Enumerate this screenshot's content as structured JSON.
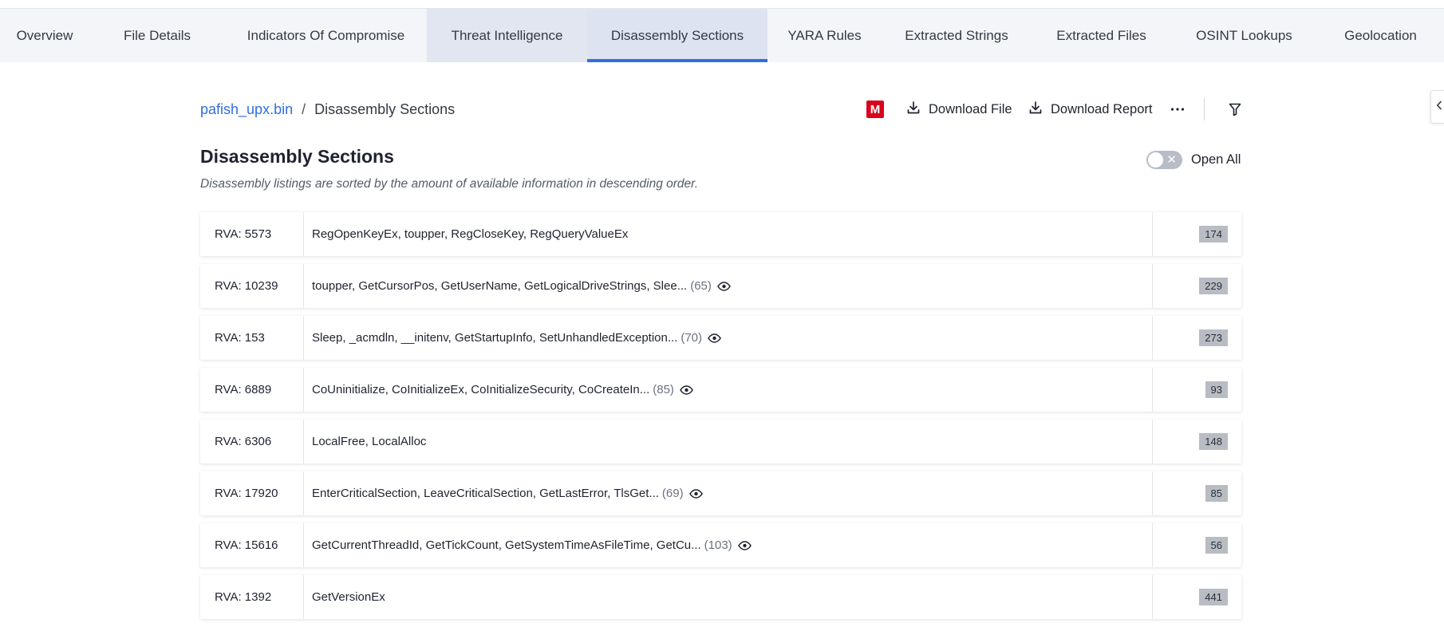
{
  "tabs": [
    {
      "label": "Overview"
    },
    {
      "label": "File Details"
    },
    {
      "label": "Indicators Of Compromise"
    },
    {
      "label": "Threat Intelligence"
    },
    {
      "label": "Disassembly Sections"
    },
    {
      "label": "YARA Rules"
    },
    {
      "label": "Extracted Strings"
    },
    {
      "label": "Extracted Files"
    },
    {
      "label": "OSINT Lookups"
    },
    {
      "label": "Geolocation"
    }
  ],
  "active_tab": "Disassembly Sections",
  "breadcrumb": {
    "file": "pafish_upx.bin",
    "separator": "/",
    "current": "Disassembly Sections"
  },
  "toolbar": {
    "badge_letter": "M",
    "badge_color": "#d9041b",
    "download_file": "Download File",
    "download_report": "Download Report",
    "more_icon": "ellipsis-icon",
    "filter_icon": "filter-icon"
  },
  "section": {
    "title": "Disassembly Sections",
    "subtitle": "Disassembly listings are sorted by the amount of available information in descending order.",
    "toggle_label": "Open All",
    "toggle_on": false
  },
  "accent_color": "#2f6fe0",
  "rows": [
    {
      "rva": "RVA: 5573",
      "functions": "RegOpenKeyEx, toupper, RegCloseKey, RegQueryValueEx",
      "more": "",
      "count": "174"
    },
    {
      "rva": "RVA: 10239",
      "functions": "toupper, GetCursorPos, GetUserName, GetLogicalDriveStrings, Slee...",
      "more": "(65)",
      "count": "229"
    },
    {
      "rva": "RVA: 153",
      "functions": "Sleep, _acmdln, __initenv, GetStartupInfo, SetUnhandledException...",
      "more": "(70)",
      "count": "273"
    },
    {
      "rva": "RVA: 6889",
      "functions": "CoUninitialize, CoInitializeEx, CoInitializeSecurity, CoCreateIn...",
      "more": "(85)",
      "count": "93"
    },
    {
      "rva": "RVA: 6306",
      "functions": "LocalFree, LocalAlloc",
      "more": "",
      "count": "148"
    },
    {
      "rva": "RVA: 17920",
      "functions": "EnterCriticalSection, LeaveCriticalSection, GetLastError, TlsGet...",
      "more": "(69)",
      "count": "85"
    },
    {
      "rva": "RVA: 15616",
      "functions": "GetCurrentThreadId, GetTickCount, GetSystemTimeAsFileTime, GetCu...",
      "more": "(103)",
      "count": "56"
    },
    {
      "rva": "RVA: 1392",
      "functions": "GetVersionEx",
      "more": "",
      "count": "441"
    }
  ]
}
